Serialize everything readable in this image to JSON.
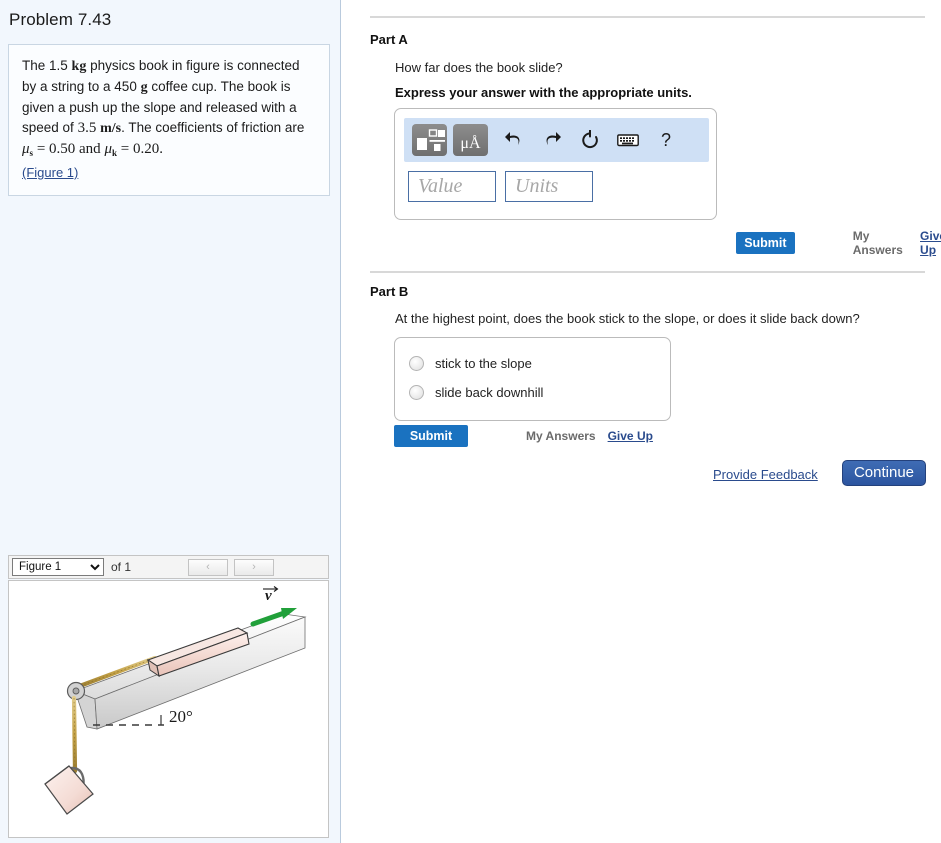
{
  "problem": {
    "title": "Problem 7.43",
    "statement_parts": {
      "p1": "The 1.5",
      "unit_kg": "kg",
      "p2": "physics book in figure is connected by a string to a 450",
      "unit_g": "g",
      "p3": "coffee cup. The book is given a push up the slope and released with a speed of",
      "speed_value": "3.5",
      "unit_ms": "m/s",
      "p4": ". The coefficients of friction are",
      "mu_s_symbol": "μ",
      "mu_s_sub": "s",
      "eq1": "= 0.50 and",
      "mu_k_symbol": "μ",
      "mu_k_sub": "k",
      "eq2": "= 0.20."
    },
    "figure_link": "(Figure 1)"
  },
  "figure_bar": {
    "selected": "Figure 1",
    "options": [
      "Figure 1"
    ],
    "of_label": "of 1",
    "prev_icon": "chevron-left-icon",
    "next_icon": "chevron-right-icon",
    "prev_glyph": "‹",
    "next_glyph": "›"
  },
  "figure": {
    "angle_label": "20°",
    "velocity_label": "v",
    "colors": {
      "book": "#f2d6d0",
      "incline": "#e2e2e2",
      "string": "#c8a84b",
      "velocity_arrow": "#21a03a",
      "cup": "#f3d9d3"
    }
  },
  "part_a": {
    "heading": "Part A",
    "question": "How far does the book slide?",
    "units_instruction": "Express your answer with the appropriate units.",
    "toolbar": {
      "template_icon": "math-template-icon",
      "units_icon": "micro-angstrom-units-icon",
      "units_icon_label": "μÅ",
      "undo_icon": "undo-arrow-icon",
      "redo_icon": "redo-arrow-icon",
      "reset_icon": "reset-circular-arrow-icon",
      "keyboard_icon": "keyboard-icon",
      "help_icon": "question-mark-icon",
      "help_glyph": "?"
    },
    "value_placeholder": "Value",
    "units_placeholder": "Units",
    "value": "",
    "units": "",
    "submit_label": "Submit",
    "my_answers_label": "My Answers",
    "give_up_label": "Give Up"
  },
  "part_b": {
    "heading": "Part B",
    "question": "At the highest point, does the book stick to the slope, or does it slide back down?",
    "choices": [
      {
        "label": "stick to the slope",
        "selected": false
      },
      {
        "label": "slide back downhill",
        "selected": false
      }
    ],
    "submit_label": "Submit",
    "my_answers_label": "My Answers",
    "give_up_label": "Give Up"
  },
  "footer": {
    "provide_feedback_label": "Provide Feedback",
    "continue_label": "Continue"
  }
}
